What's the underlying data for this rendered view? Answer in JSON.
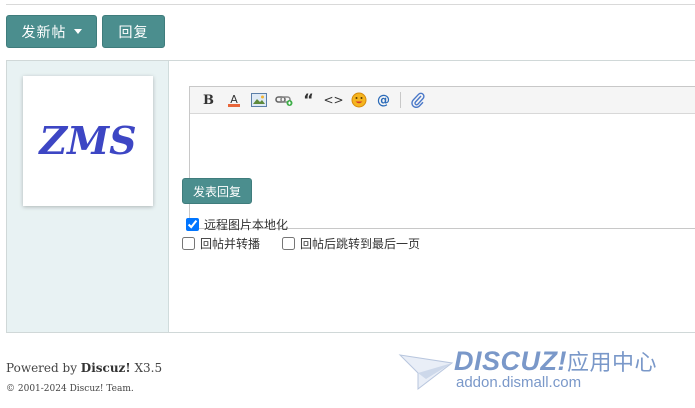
{
  "buttons": {
    "new_post": "发新帖",
    "reply": "回复",
    "submit_reply": "发表回复"
  },
  "avatar": {
    "text": "ZMS",
    "color": "#3d46c4"
  },
  "toolbar": [
    {
      "name": "bold-icon",
      "glyph": "B"
    },
    {
      "name": "font-color-icon",
      "glyph": "A"
    },
    {
      "name": "image-icon",
      "glyph": ""
    },
    {
      "name": "link-icon",
      "glyph": ""
    },
    {
      "name": "quote-icon",
      "glyph": "“"
    },
    {
      "name": "code-icon",
      "glyph": "<>"
    },
    {
      "name": "smiley-icon",
      "glyph": ""
    },
    {
      "name": "mention-icon",
      "glyph": "@"
    },
    {
      "name": "attachment-icon",
      "glyph": ""
    }
  ],
  "options": {
    "remote_image": {
      "label": "远程图片本地化",
      "checked": true
    },
    "repost": {
      "label": "回帖并转播",
      "checked": false
    },
    "jump_last": {
      "label": "回帖后跳转到最后一页",
      "checked": false
    }
  },
  "footer": {
    "powered_prefix": "Powered by ",
    "powered_brand": "Discuz!",
    "powered_version": " X3.5",
    "copyright": "© 2001-2024 Discuz! Team."
  },
  "watermark": {
    "brand": "DISCUZ!",
    "cn": "应用中心",
    "url": "addon.dismall.com"
  },
  "colors": {
    "accent": "#4b8e8e",
    "side_bg": "#e8f2f3"
  }
}
